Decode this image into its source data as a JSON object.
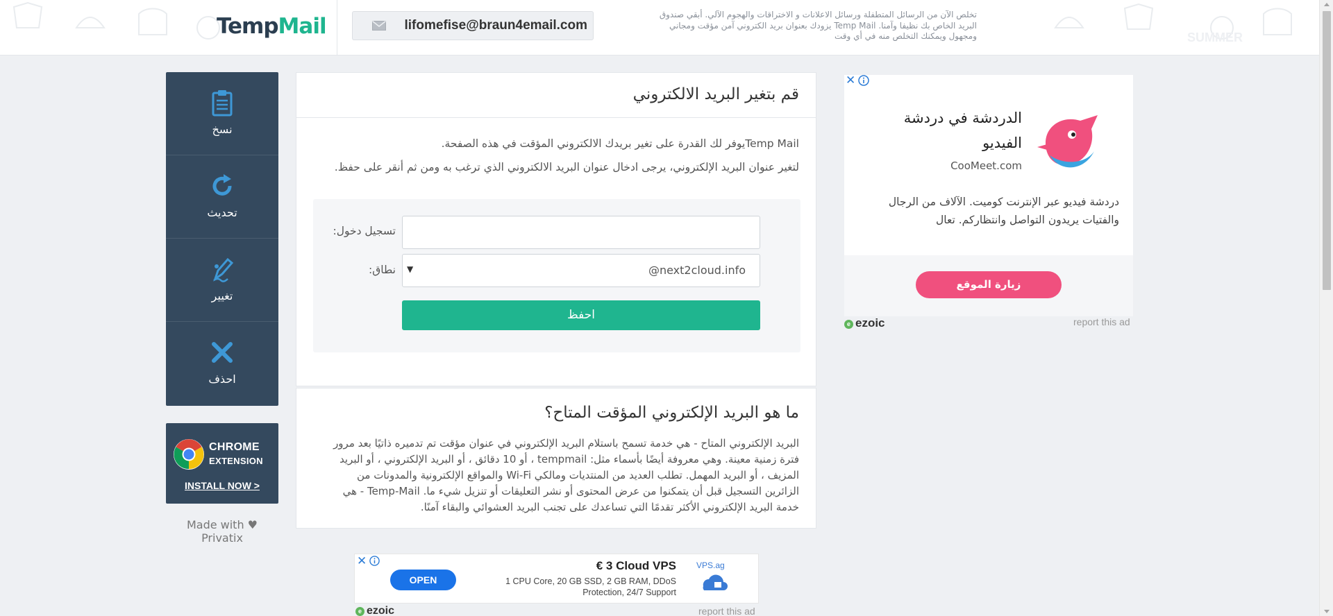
{
  "header": {
    "logo_part1": "Temp",
    "logo_part2": "Mail",
    "email": "lifomefise@braun4email.com",
    "tagline": "تخلص الآن من الرسائل المتطفلة ورسائل الاعلانات و الاختراقات والهجوم الآلي. أبقي صندوق البريد الخاص بك نظيفا وآمنا. Temp Mail يزودك بعنوان بريد الكتروني آمن مؤقت ومجاني ومجهول ويمكنك التخلص منه في أي وقت",
    "deco_text": "SUMMER"
  },
  "sidebar": {
    "actions": [
      {
        "label": "نسخ",
        "icon": "clipboard-icon"
      },
      {
        "label": "تحديث",
        "icon": "refresh-icon"
      },
      {
        "label": "تغيير",
        "icon": "edit-icon"
      },
      {
        "label": "احذف",
        "icon": "delete-x-icon"
      }
    ],
    "chrome": {
      "line1": "CHROME",
      "line2": "EXTENSION",
      "install": "INSTALL NOW >"
    },
    "made_with": "Made with ♥ Privatix"
  },
  "main": {
    "title": "قم بتغير البريد الالكتروني",
    "p1": "Temp Mailيوفر لك القدرة على تغير بريدك الالكتروني المؤقت في هذه الصفحة.",
    "p2": "لتغير عنوان البريد الإلكتروني، يرجى ادخال عنوان البريد الالكتروني الذي ترغب به ومن ثم أنقر على حفظ.",
    "form": {
      "login_label": "تسجيل دخول:",
      "login_value": "",
      "domain_label": "نطاق:",
      "domain_value": "@next2cloud.info",
      "save_label": "احفظ"
    }
  },
  "info": {
    "title": "ما هو البريد الإلكتروني المؤقت المتاح؟",
    "body": "البريد الإلكتروني المتاح - هي خدمة تسمح باستلام البريد الإلكتروني في عنوان مؤقت تم تدميره ذاتيًا بعد مرور فترة زمنية معينة. وهي معروفة أيضًا بأسماء مثل: tempmail ، أو 10 دقائق ، أو البريد الإلكتروني ، أو البريد المزيف ، أو البريد المهمل. تطلب العديد من المنتديات ومالكي Wi-Fi والمواقع الإلكترونية والمدونات من الزائرين التسجيل قبل أن يتمكنوا من عرض المحتوى أو نشر التعليقات أو تنزيل شيء ما. Temp-Mail - هي خدمة البريد الإلكتروني الأكثر تقدمًا التي تساعدك على تجنب البريد العشوائي والبقاء آمنًا."
  },
  "ad_right": {
    "title": "الدردشة في دردشة الفيديو",
    "domain": "CooMeet.com",
    "description": "دردشة فيديو عبر الإنترنت كوميت. الآلاف من الرجال والفتيات يريدون التواصل وانتظاركم. تعال",
    "button": "زيارة الموقع",
    "network": "ezoic",
    "report": "report this ad",
    "colors": {
      "button": "#f0507e",
      "bird": "#f0507e"
    }
  },
  "ad_bottom": {
    "open": "OPEN",
    "title": "€ 3 Cloud VPS",
    "description": "1 CPU Core, 20 GB SSD, 2 GB RAM, DDoS Protection, 24/7 Support",
    "logo_text": "VPS.ag",
    "network": "ezoic",
    "report": "report this ad"
  },
  "colors": {
    "accent": "#1fb58f",
    "panel": "#34495e",
    "background": "#eef0f3"
  }
}
